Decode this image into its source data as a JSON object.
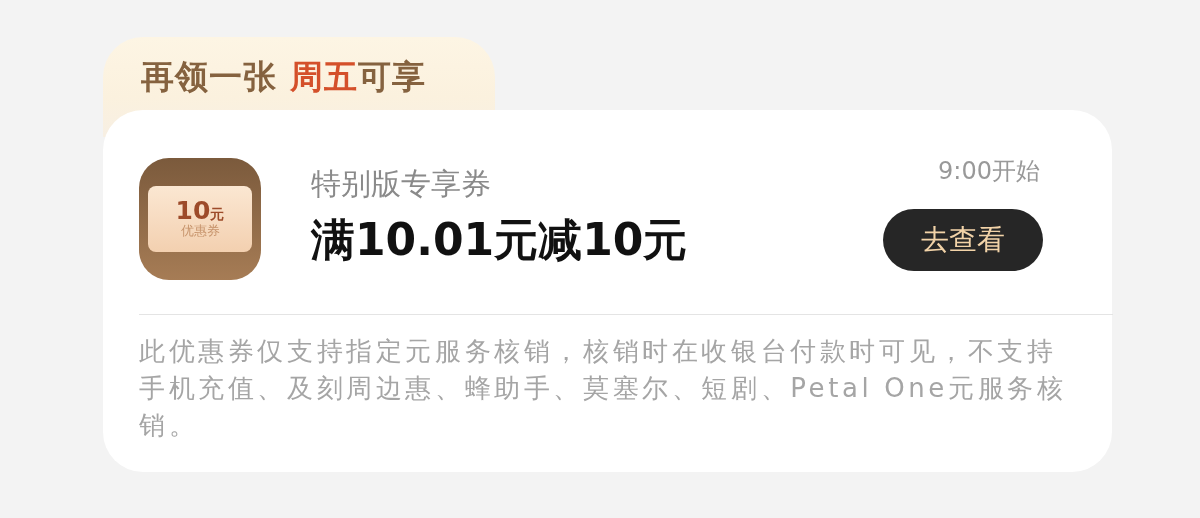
{
  "banner": {
    "parts": [
      {
        "text": "再领一张 ",
        "highlight": false
      },
      {
        "text": "周五",
        "highlight": true
      },
      {
        "text": "可享",
        "highlight": false
      }
    ]
  },
  "coupon": {
    "badge": {
      "amount": "10",
      "unit": "元",
      "label": "优惠券"
    },
    "subtitle": "特别版专享券",
    "title": "满10.01元减10元",
    "time": "9:00开始",
    "button": "去查看"
  },
  "note": "此优惠券仅支持指定元服务核销，核销时在收银台付款时可见，不支持手机充值、及刻周边惠、蜂助手、莫塞尔、短剧、Petal One元服务核销。"
}
